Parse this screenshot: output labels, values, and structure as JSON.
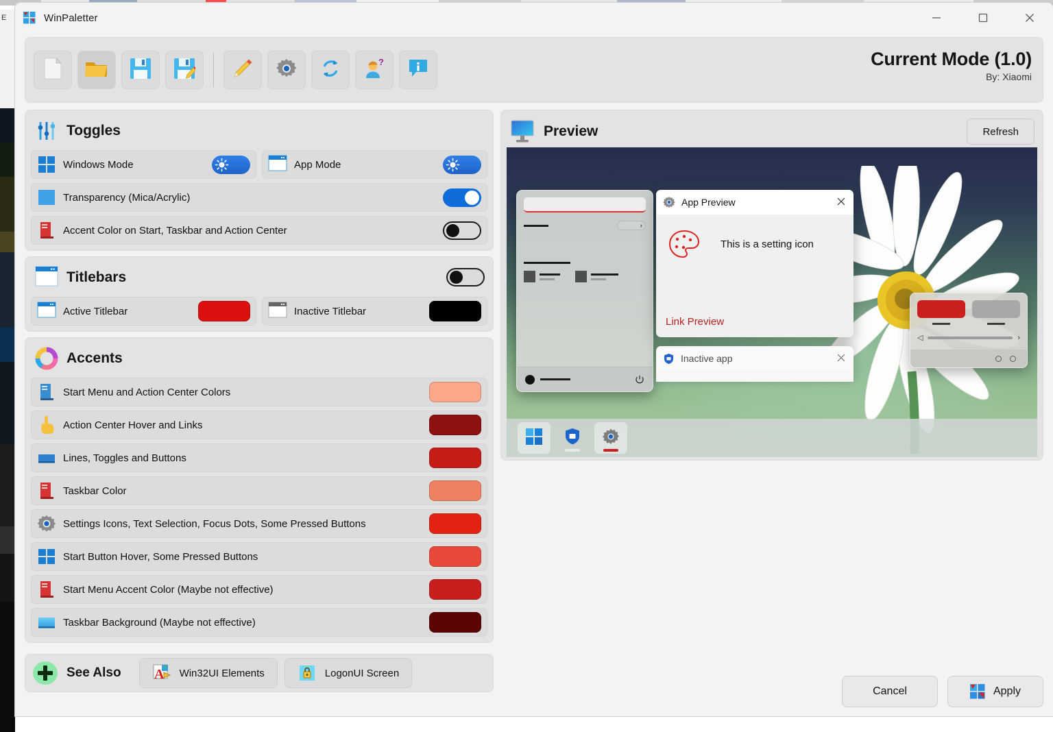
{
  "window": {
    "title": "WinPaletter",
    "icon": "winpaletter-logo-icon",
    "controls": {
      "minimize": "—",
      "maximize": "▢",
      "close": "✕"
    }
  },
  "toolbar": {
    "buttons": [
      {
        "name": "new-file-button",
        "icon": "new-file-icon",
        "tooltip": "New"
      },
      {
        "name": "open-file-button",
        "icon": "open-folder-icon",
        "tooltip": "Open"
      },
      {
        "name": "save-button",
        "icon": "save-floppy-icon",
        "tooltip": "Save"
      },
      {
        "name": "save-as-button",
        "icon": "save-as-floppy-pencil-icon",
        "tooltip": "Save As"
      },
      {
        "name": "edit-button",
        "icon": "pencil-icon",
        "tooltip": "Edit"
      },
      {
        "name": "settings-button",
        "icon": "gear-icon",
        "tooltip": "Settings"
      },
      {
        "name": "reset-button",
        "icon": "refresh-sync-icon",
        "tooltip": "Reset"
      },
      {
        "name": "account-button",
        "icon": "user-question-icon",
        "tooltip": "Account"
      },
      {
        "name": "info-button",
        "icon": "info-speech-icon",
        "tooltip": "Info"
      }
    ],
    "mode_title": "Current Mode (1.0)",
    "mode_author": "By: Xiaomi"
  },
  "toggles_section": {
    "title": "Toggles",
    "icon": "sliders-icon",
    "rows": [
      {
        "label": "Windows Mode",
        "icon": "windows-logo-icon",
        "toggle": "light",
        "state": "light-mode"
      },
      {
        "label": "App Mode",
        "icon": "app-window-icon",
        "toggle": "light",
        "state": "light-mode"
      },
      {
        "label": "Transparency (Mica/Acrylic)",
        "icon": "blue-square-icon",
        "toggle": "on",
        "state": "on"
      },
      {
        "label": "Accent Color on Start, Taskbar and Action Center",
        "icon": "red-server-icon",
        "toggle": "off",
        "state": "off"
      }
    ]
  },
  "titlebars_section": {
    "title": "Titlebars",
    "icon": "titlebar-window-icon",
    "master_toggle": "off",
    "rows": [
      {
        "label": "Active Titlebar",
        "icon": "active-window-icon",
        "color": "#dd1010"
      },
      {
        "label": "Inactive Titlebar",
        "icon": "inactive-window-icon",
        "color": "#000000"
      }
    ]
  },
  "accents_section": {
    "title": "Accents",
    "icon": "color-wheel-icon",
    "rows": [
      {
        "label": "Start Menu and Action Center Colors",
        "icon": "start-menu-icon",
        "color": "#fca68a"
      },
      {
        "label": "Action Center Hover and Links",
        "icon": "pointing-hand-icon",
        "color": "#8d1111"
      },
      {
        "label": "Lines, Toggles and Buttons",
        "icon": "blue-bar-icon",
        "color": "#c61c18"
      },
      {
        "label": "Taskbar Color",
        "icon": "red-server-icon",
        "color": "#f08062"
      },
      {
        "label": "Settings Icons, Text Selection, Focus Dots, Some Pressed Buttons",
        "icon": "gear-icon",
        "color": "#e32213"
      },
      {
        "label": "Start Button Hover, Some Pressed Buttons",
        "icon": "windows-logo-icon",
        "color": "#e8483a"
      },
      {
        "label": "Start Menu Accent Color (Maybe not effective)",
        "icon": "red-server-icon",
        "color": "#c91f1c"
      },
      {
        "label": "Taskbar Background (Maybe not effective)",
        "icon": "taskbar-gradient-icon",
        "color": "#5c0505"
      }
    ]
  },
  "see_also": {
    "title": "See Also",
    "icon": "plus-circle-icon",
    "buttons": [
      {
        "label": "Win32UI Elements",
        "icon": "win32ui-icon"
      },
      {
        "label": "LogonUI Screen",
        "icon": "lock-icon"
      }
    ]
  },
  "preview": {
    "title": "Preview",
    "icon": "monitor-icon",
    "refresh_label": "Refresh",
    "app_window": {
      "title": "App Preview",
      "icon": "gear-icon",
      "close": "✕",
      "setting_text": "This is a setting icon",
      "setting_icon": "palette-icon",
      "link_text": "Link Preview"
    },
    "inactive_window": {
      "title": "Inactive app",
      "icon": "shield-icon",
      "close": "✕"
    },
    "action_center": {
      "tile_on_color": "#cc2020",
      "tile_off_color": "#a8a8a8"
    },
    "taskbar_items": [
      {
        "name": "start-button",
        "icon": "windows-logo-icon",
        "highlight": true,
        "indicator": "none"
      },
      {
        "name": "security-button",
        "icon": "shield-icon",
        "highlight": false,
        "indicator": "#e8e8e8"
      },
      {
        "name": "settings-button",
        "icon": "gear-icon",
        "highlight": true,
        "indicator": "#c62222"
      }
    ]
  },
  "footer": {
    "cancel_label": "Cancel",
    "apply_label": "Apply",
    "apply_icon": "winpaletter-logo-icon"
  },
  "colors": {
    "accent_blue": "#0f6cdb",
    "window_bg": "#f3f3f3",
    "card_bg": "#e3e3e3",
    "row_bg": "#dcdcdc"
  }
}
